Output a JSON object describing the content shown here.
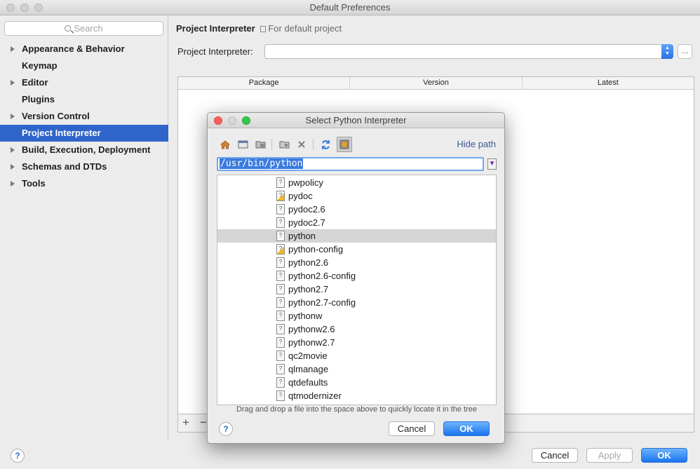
{
  "window": {
    "title": "Default Preferences"
  },
  "sidebar": {
    "search_placeholder": "Search",
    "items": [
      {
        "label": "Appearance & Behavior",
        "expandable": true
      },
      {
        "label": "Keymap",
        "expandable": false
      },
      {
        "label": "Editor",
        "expandable": true
      },
      {
        "label": "Plugins",
        "expandable": false
      },
      {
        "label": "Version Control",
        "expandable": true
      },
      {
        "label": "Project Interpreter",
        "expandable": false,
        "selected": true
      },
      {
        "label": "Build, Execution, Deployment",
        "expandable": true
      },
      {
        "label": "Schemas and DTDs",
        "expandable": true
      },
      {
        "label": "Tools",
        "expandable": true
      }
    ]
  },
  "main": {
    "breadcrumb_title": "Project Interpreter",
    "breadcrumb_sub": "For default project",
    "interpreter_label": "Project Interpreter:",
    "interpreter_value": "",
    "more_button": "...",
    "table": {
      "columns": [
        "Package",
        "Version",
        "Latest"
      ]
    },
    "add_button": "+",
    "remove_button": "−"
  },
  "footer": {
    "help": "?",
    "cancel": "Cancel",
    "apply": "Apply",
    "ok": "OK"
  },
  "dialog": {
    "title": "Select Python Interpreter",
    "hide_path": "Hide path",
    "path_value": "/usr/bin/python",
    "files": [
      {
        "name": "pwpolicy",
        "exec": false
      },
      {
        "name": "pydoc",
        "exec": true
      },
      {
        "name": "pydoc2.6",
        "exec": false
      },
      {
        "name": "pydoc2.7",
        "exec": false
      },
      {
        "name": "python",
        "exec": false,
        "selected": true
      },
      {
        "name": "python-config",
        "exec": true
      },
      {
        "name": "python2.6",
        "exec": false
      },
      {
        "name": "python2.6-config",
        "exec": false
      },
      {
        "name": "python2.7",
        "exec": false
      },
      {
        "name": "python2.7-config",
        "exec": false
      },
      {
        "name": "pythonw",
        "exec": false
      },
      {
        "name": "pythonw2.6",
        "exec": false
      },
      {
        "name": "pythonw2.7",
        "exec": false
      },
      {
        "name": "qc2movie",
        "exec": false
      },
      {
        "name": "qlmanage",
        "exec": false
      },
      {
        "name": "qtdefaults",
        "exec": false
      },
      {
        "name": "qtmodernizer",
        "exec": false
      }
    ],
    "hint": "Drag and drop a file into the space above to quickly locate it in the tree",
    "help": "?",
    "cancel": "Cancel",
    "ok": "OK"
  },
  "colors": {
    "selection": "#2f65ca",
    "primary_button": "#1b74f0"
  }
}
